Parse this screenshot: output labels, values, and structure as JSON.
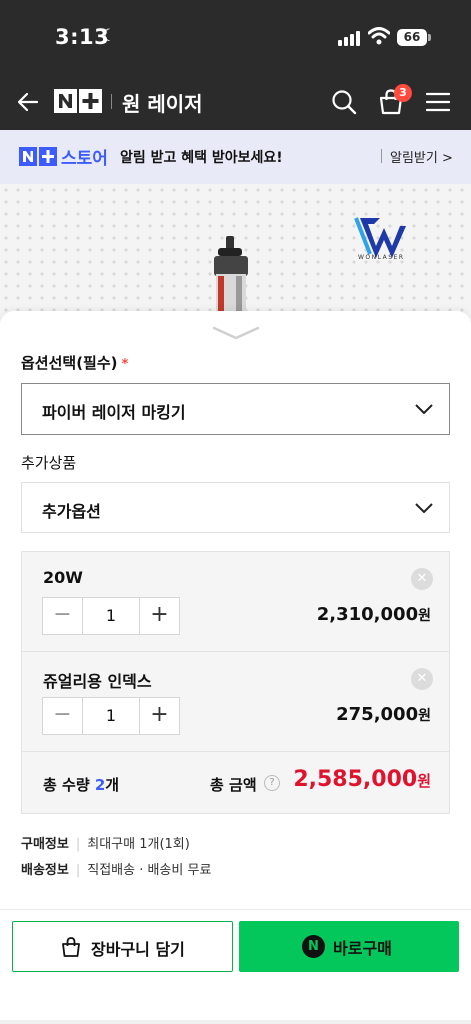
{
  "status": {
    "time": "3:13",
    "battery": "66"
  },
  "header": {
    "logo": "N+",
    "title": "원 레이저",
    "cart_count": "3"
  },
  "promo": {
    "store_label": "스토어",
    "message": "알림 받고 혜택 받아보세요!",
    "link": "알림받기 >"
  },
  "hero": {
    "brand_text": "WONLASER"
  },
  "options": {
    "required_label": "옵션선택(필수)",
    "required_mark": "*",
    "selected_value": "파이버 레이저 마킹기",
    "addon_label": "추가상품",
    "addon_value": "추가옵션"
  },
  "items": [
    {
      "name": "20W",
      "qty": "1",
      "price": "2,310,000",
      "unit": "원"
    },
    {
      "name": "쥬얼리용 인덱스",
      "qty": "1",
      "price": "275,000",
      "unit": "원"
    }
  ],
  "total": {
    "qty_prefix": "총 수량",
    "qty": "2",
    "qty_suffix": "개",
    "amount_label": "총 금액",
    "amount": "2,585,000",
    "unit": "원"
  },
  "info": [
    {
      "key": "구매정보",
      "value": "최대구매 1개(1회)"
    },
    {
      "key": "배송정보",
      "value": "직접배송 · 배송비 무료"
    }
  ],
  "buttons": {
    "cart": "장바구니 담기",
    "buy": "바로구매"
  }
}
